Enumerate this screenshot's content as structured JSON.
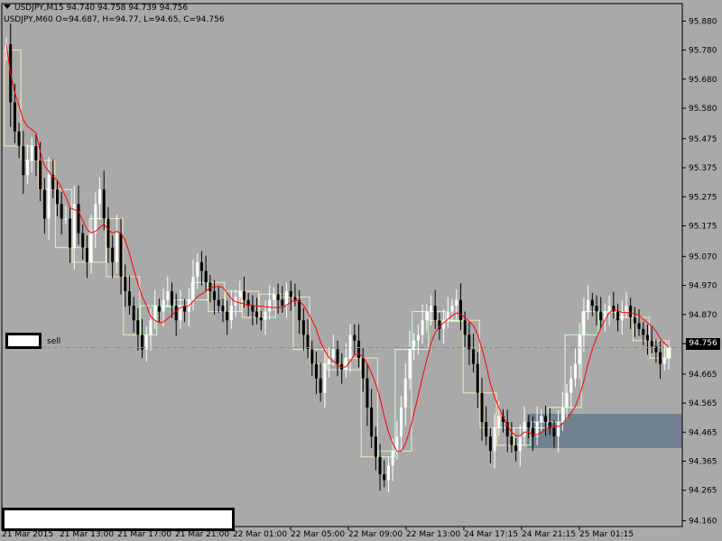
{
  "header": {
    "line1": "USDJPY,M15  94.740 94.758 94.739 94.756",
    "line2": "USDJPY,M60  O=94.687,  H=94.77,  L=94.65,  C=94.756"
  },
  "sell_label": "sell",
  "current_price_tag": "94.756",
  "price_axis_labels": [
    "95.880",
    "95.780",
    "95.680",
    "95.580",
    "95.475",
    "95.375",
    "95.275",
    "95.175",
    "95.070",
    "94.970",
    "94.870",
    "94.770",
    "94.665",
    "94.565",
    "94.465",
    "94.365",
    "94.265",
    "94.160"
  ],
  "time_axis_labels": [
    "21 Mar 2015",
    "21 Mar 13:00",
    "21 Mar 17:00",
    "21 Mar 21:00",
    "22 Mar 01:00",
    "22 Mar 05:00",
    "22 Mar 09:00",
    "22 Mar 13:00",
    "24 Mar 17:15",
    "24 Mar 21:15",
    "25 Mar 01:15"
  ],
  "colors": {
    "background": "#a9a9a9",
    "bull_candle": "#ffffff",
    "bear_candle": "#000000",
    "m60_bull_box": "#ccffcc",
    "m60_bear_box": "#ffe4b5",
    "moving_average": "#ff0000",
    "price_line": "#32cd32",
    "zone": "#708090"
  },
  "chart_data": {
    "type": "candlestick",
    "symbol": "USDJPY",
    "timeframe": "M15",
    "overlay_timeframe": "M60",
    "ylim": [
      94.14,
      95.94
    ],
    "current_price": 94.756,
    "closes": [
      95.8,
      95.6,
      95.5,
      95.45,
      95.35,
      95.4,
      95.45,
      95.4,
      95.3,
      95.2,
      95.35,
      95.3,
      95.25,
      95.2,
      95.2,
      95.1,
      95.25,
      95.15,
      95.1,
      95.05,
      95.15,
      95.25,
      95.3,
      95.2,
      95.1,
      95.05,
      95.15,
      95.0,
      94.95,
      94.9,
      94.85,
      94.8,
      94.75,
      94.8,
      94.85,
      94.9,
      94.88,
      94.92,
      94.95,
      94.9,
      94.85,
      94.9,
      94.88,
      94.92,
      95.0,
      95.05,
      95.02,
      94.98,
      94.95,
      94.92,
      94.9,
      94.88,
      94.85,
      94.9,
      94.93,
      94.95,
      94.92,
      94.9,
      94.88,
      94.86,
      94.85,
      94.88,
      94.92,
      94.94,
      94.92,
      94.9,
      94.95,
      94.93,
      94.92,
      94.85,
      94.8,
      94.75,
      94.7,
      94.65,
      94.6,
      94.7,
      94.72,
      94.75,
      94.7,
      94.68,
      94.72,
      94.8,
      94.78,
      94.72,
      94.65,
      94.55,
      94.45,
      94.38,
      94.32,
      94.3,
      94.35,
      94.4,
      94.45,
      94.55,
      94.65,
      94.75,
      94.78,
      94.8,
      94.85,
      94.88,
      94.9,
      94.85,
      94.82,
      94.85,
      94.88,
      94.9,
      94.92,
      94.85,
      94.8,
      94.75,
      94.7,
      94.6,
      94.5,
      94.45,
      94.4,
      94.48,
      94.52,
      94.5,
      94.45,
      94.42,
      94.4,
      94.45,
      94.5,
      94.48,
      94.45,
      94.5,
      94.52,
      94.5,
      94.48,
      94.45,
      94.5,
      94.55,
      94.6,
      94.65,
      94.7,
      94.8,
      94.88,
      94.92,
      94.9,
      94.88,
      94.85,
      94.88,
      94.9,
      94.88,
      94.85,
      94.88,
      94.9,
      94.86,
      94.84,
      94.82,
      94.8,
      94.78,
      94.76,
      94.74,
      94.7,
      94.72,
      94.756
    ]
  }
}
